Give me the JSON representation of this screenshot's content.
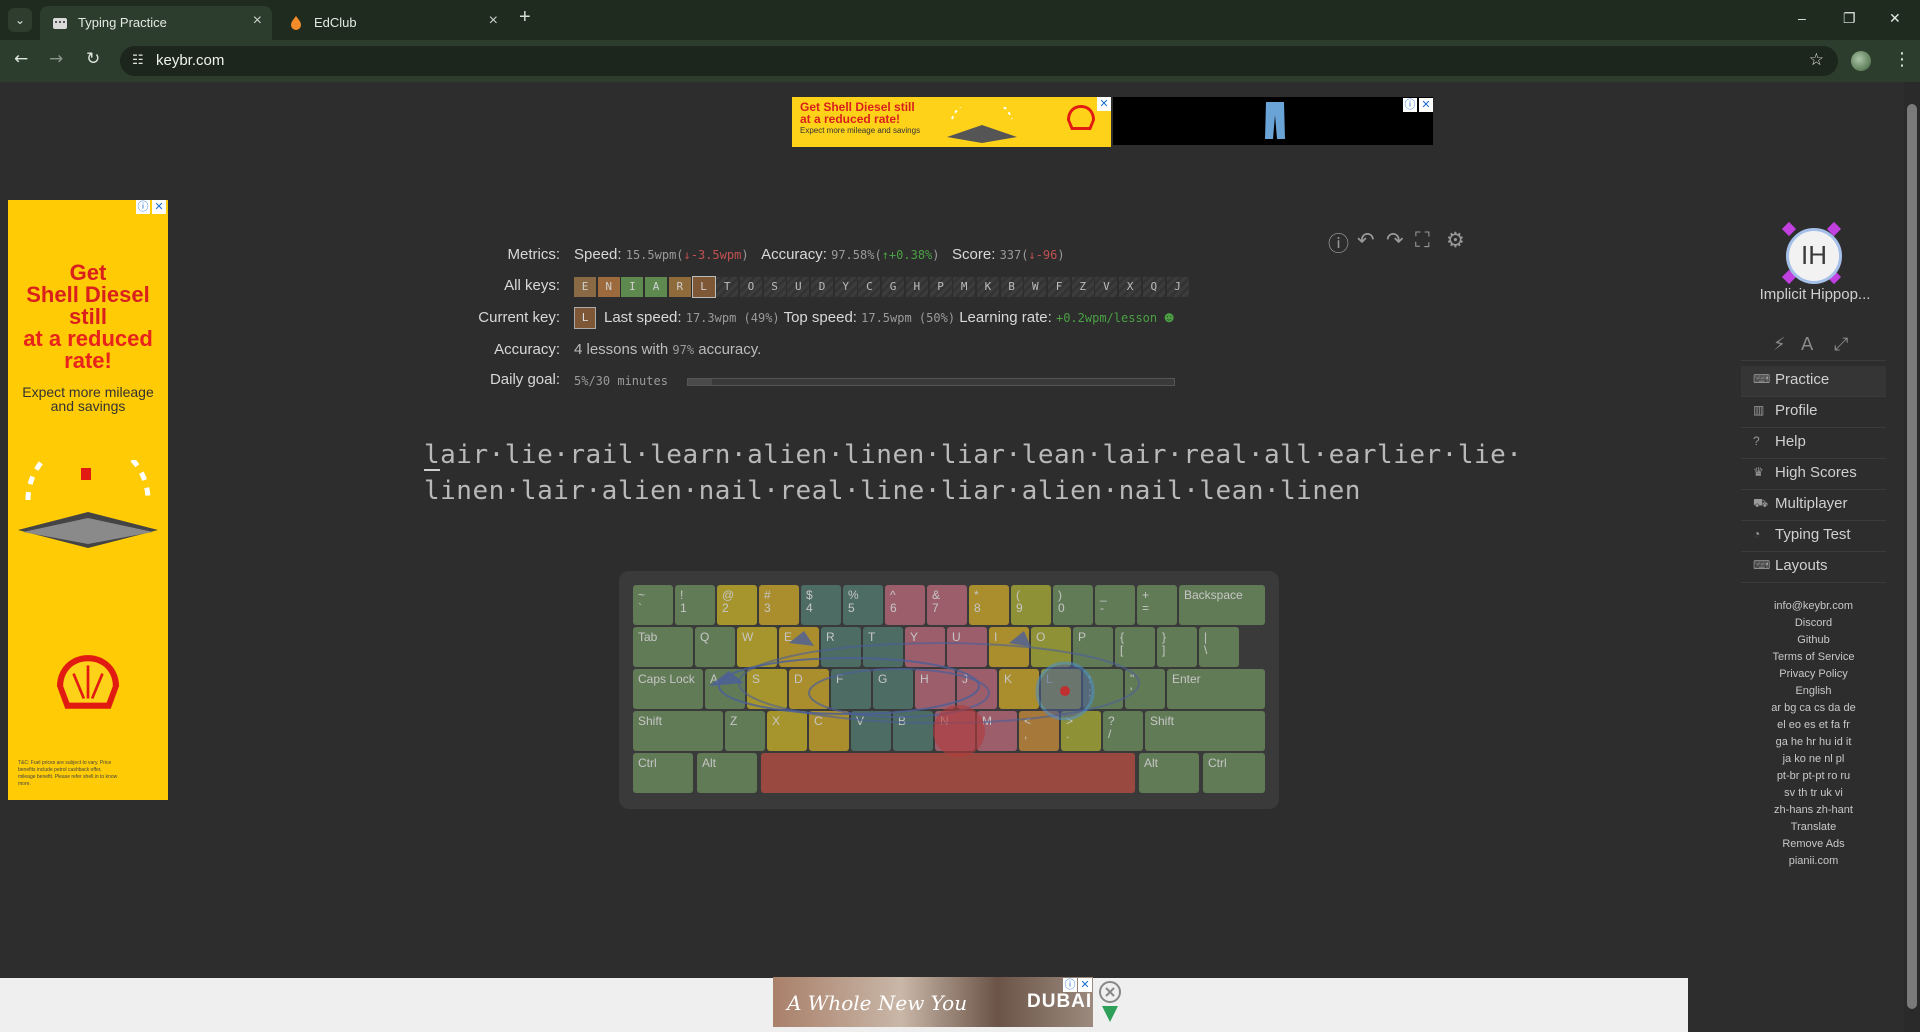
{
  "browser": {
    "tabs": [
      {
        "title": "Typing Practice",
        "active": true
      },
      {
        "title": "EdClub",
        "active": false
      }
    ],
    "url": "keybr.com",
    "new_tab": "+",
    "minimize": "–",
    "maximize": "❐",
    "close": "✕"
  },
  "ads": {
    "top_left_line1": "Get Shell Diesel still",
    "top_left_line2": "at a reduced rate!",
    "top_left_line3": "Expect more mileage and savings",
    "left_lines": [
      "Get",
      "Shell Diesel",
      "still"
    ],
    "left_red_lines": [
      "at a reduced",
      "rate!"
    ],
    "left_sub": "Expect more mileage and savings",
    "left_fine": "T&C: Fuel prices are subject to vary. Price benefits include petrol cashback offer, mileage benefit. Please refer shell.in to know more.",
    "bottom_text": "A Whole New You",
    "bottom_brand": "DUBAI"
  },
  "metrics": {
    "label_metrics": "Metrics:",
    "speed_label": "Speed:",
    "speed_value": "15.5wpm",
    "speed_delta": "↓-3.5wpm",
    "accuracy_label": "Accuracy:",
    "accuracy_value": "97.58%",
    "accuracy_delta": "↑+0.38%",
    "score_label": "Score:",
    "score_value": "337",
    "score_delta": "↓-96",
    "label_all_keys": "All keys:",
    "keys": [
      {
        "k": "E",
        "color": "#8a6a44"
      },
      {
        "k": "N",
        "color": "#9c6a3c"
      },
      {
        "k": "I",
        "color": "#5e8a50"
      },
      {
        "k": "A",
        "color": "#5e8a50"
      },
      {
        "k": "R",
        "color": "#8f6a3a"
      },
      {
        "k": "L",
        "color": "#7e5737"
      },
      {
        "k": "T",
        "color": ""
      },
      {
        "k": "O",
        "color": ""
      },
      {
        "k": "S",
        "color": ""
      },
      {
        "k": "U",
        "color": ""
      },
      {
        "k": "D",
        "color": ""
      },
      {
        "k": "Y",
        "color": ""
      },
      {
        "k": "C",
        "color": ""
      },
      {
        "k": "G",
        "color": ""
      },
      {
        "k": "H",
        "color": ""
      },
      {
        "k": "P",
        "color": ""
      },
      {
        "k": "M",
        "color": ""
      },
      {
        "k": "K",
        "color": ""
      },
      {
        "k": "B",
        "color": ""
      },
      {
        "k": "W",
        "color": ""
      },
      {
        "k": "F",
        "color": ""
      },
      {
        "k": "Z",
        "color": ""
      },
      {
        "k": "V",
        "color": ""
      },
      {
        "k": "X",
        "color": ""
      },
      {
        "k": "Q",
        "color": ""
      },
      {
        "k": "J",
        "color": ""
      }
    ],
    "label_current_key": "Current key:",
    "current_key": "L",
    "last_speed_label": "Last speed:",
    "last_speed_value": "17.3wpm (49%)",
    "top_speed_label": "Top speed:",
    "top_speed_value": "17.5wpm (50%)",
    "learning_rate_label": "Learning rate:",
    "learning_rate_value": "+0.2wpm/lesson",
    "label_accuracy": "Accuracy:",
    "accuracy_text_1": "4 lessons with",
    "accuracy_text_pct": "97%",
    "accuracy_text_2": "accuracy.",
    "label_daily_goal": "Daily goal:",
    "daily_goal_value": "5%/30 minutes",
    "daily_goal_progress": 0.05
  },
  "lesson": {
    "line1": "lair·lie·rail·learn·alien·linen·liar·lean·lair·real·all·earlier·lie·",
    "line2": "linen·lair·alien·nail·real·line·liar·alien·nail·lean·linen"
  },
  "keyboard": {
    "row1": [
      {
        "top": "~",
        "bot": "`",
        "c": "c-green"
      },
      {
        "top": "!",
        "bot": "1",
        "c": "c-green"
      },
      {
        "top": "@",
        "bot": "2",
        "c": "c-olive"
      },
      {
        "top": "#",
        "bot": "3",
        "c": "c-mustard"
      },
      {
        "top": "$",
        "bot": "4",
        "c": "c-teal"
      },
      {
        "top": "%",
        "bot": "5",
        "c": "c-teal"
      },
      {
        "top": "^",
        "bot": "6",
        "c": "c-pink"
      },
      {
        "top": "&",
        "bot": "7",
        "c": "c-pink"
      },
      {
        "top": "*",
        "bot": "8",
        "c": "c-mustard"
      },
      {
        "top": "(",
        "bot": "9",
        "c": "c-khaki"
      },
      {
        "top": ")",
        "bot": "0",
        "c": "c-green"
      },
      {
        "top": "_",
        "bot": "-",
        "c": "c-green"
      },
      {
        "top": "+",
        "bot": "=",
        "c": "c-green"
      }
    ],
    "backspace": "Backspace",
    "tab": "Tab",
    "row2": [
      {
        "top": "Q",
        "c": "c-green"
      },
      {
        "top": "W",
        "c": "c-olive"
      },
      {
        "top": "E",
        "c": "c-mustard"
      },
      {
        "top": "R",
        "c": "c-teal"
      },
      {
        "top": "T",
        "c": "c-teal"
      },
      {
        "top": "Y",
        "c": "c-pink"
      },
      {
        "top": "U",
        "c": "c-pink"
      },
      {
        "top": "I",
        "c": "c-mustard"
      },
      {
        "top": "O",
        "c": "c-khaki"
      },
      {
        "top": "P",
        "c": "c-green"
      },
      {
        "top": "{",
        "bot": "[",
        "c": "c-green"
      },
      {
        "top": "}",
        "bot": "]",
        "c": "c-green"
      },
      {
        "top": "|",
        "bot": "\\",
        "c": "c-green"
      }
    ],
    "caps": "Caps Lock",
    "row3": [
      {
        "top": "A",
        "c": "c-green"
      },
      {
        "top": "S",
        "c": "c-olive"
      },
      {
        "top": "D",
        "c": "c-mustard"
      },
      {
        "top": "F",
        "c": "c-teal"
      },
      {
        "top": "G",
        "c": "c-teal"
      },
      {
        "top": "H",
        "c": "c-pink"
      },
      {
        "top": "J",
        "c": "c-pink"
      },
      {
        "top": "K",
        "c": "c-mustard"
      },
      {
        "top": "L",
        "c": "c-khaki"
      },
      {
        "top": ":",
        "bot": ";",
        "c": "c-green"
      },
      {
        "top": "\"",
        "bot": "'",
        "c": "c-green"
      }
    ],
    "enter": "Enter",
    "shift": "Shift",
    "row4": [
      {
        "top": "Z",
        "c": "c-green"
      },
      {
        "top": "X",
        "c": "c-olive"
      },
      {
        "top": "C",
        "c": "c-mustard"
      },
      {
        "top": "V",
        "c": "c-teal"
      },
      {
        "top": "B",
        "c": "c-teal"
      },
      {
        "top": "N",
        "c": "c-pink"
      },
      {
        "top": "M",
        "c": "c-pink"
      },
      {
        "top": "<",
        "bot": ",",
        "c": "c-orange"
      },
      {
        "top": ">",
        "bot": ".",
        "c": "c-khaki"
      },
      {
        "top": "?",
        "bot": "/",
        "c": "c-green"
      }
    ],
    "ctrl": "Ctrl",
    "alt": "Alt"
  },
  "sidebar": {
    "profile_initials": "IH",
    "profile_name": "Implicit Hippop...",
    "nav": [
      {
        "label": "Practice",
        "icon": "keyboard-icon"
      },
      {
        "label": "Profile",
        "icon": "chart-icon"
      },
      {
        "label": "Help",
        "icon": "help-icon"
      },
      {
        "label": "High Scores",
        "icon": "trophy-icon"
      },
      {
        "label": "Multiplayer",
        "icon": "car-icon"
      },
      {
        "label": "Typing Test",
        "icon": "gauge-icon"
      },
      {
        "label": "Layouts",
        "icon": "keyboard-icon"
      }
    ],
    "footer": [
      "info@keybr.com",
      "Discord",
      "Github",
      "Terms of Service",
      "Privacy Policy",
      "English",
      "ar bg ca cs da de",
      "el eo es et fa fr",
      "ga he hr hu id it",
      "ja ko ne nl pl",
      "pt-br pt-pt ro ru",
      "sv th tr uk vi",
      "zh-hans zh-hant",
      "Translate",
      "Remove Ads",
      "pianii.com"
    ]
  }
}
